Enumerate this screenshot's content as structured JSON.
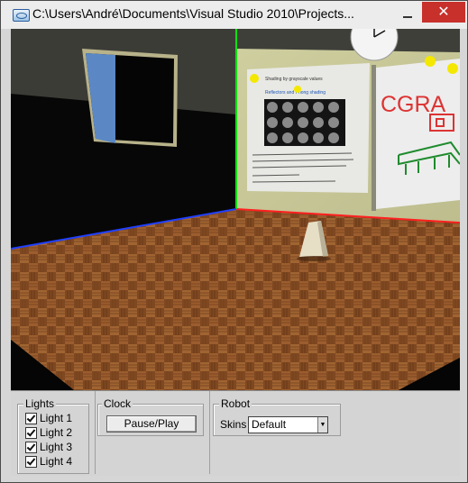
{
  "window": {
    "title": "C:\\Users\\André\\Documents\\Visual Studio 2010\\Projects...",
    "close_glyph": "✕"
  },
  "scene": {
    "whiteboard_text": "CGRA",
    "poster_line1": "Shading by grayscale values",
    "poster_line2": "Reflectors and Phong shading"
  },
  "controls": {
    "lights": {
      "title": "Lights",
      "items": [
        {
          "label": "Light 1",
          "checked": true
        },
        {
          "label": "Light 2",
          "checked": true
        },
        {
          "label": "Light 3",
          "checked": true
        },
        {
          "label": "Light 4",
          "checked": true
        }
      ]
    },
    "clock": {
      "title": "Clock",
      "button_label": "Pause/Play"
    },
    "robot": {
      "title": "Robot",
      "skins_label": "Skins",
      "skins_value": "Default"
    }
  },
  "colors": {
    "close_button": "#c7302b",
    "floor": "#8a4f26",
    "wall": "#cfcf9e",
    "light_bulb": "#f4e800"
  }
}
